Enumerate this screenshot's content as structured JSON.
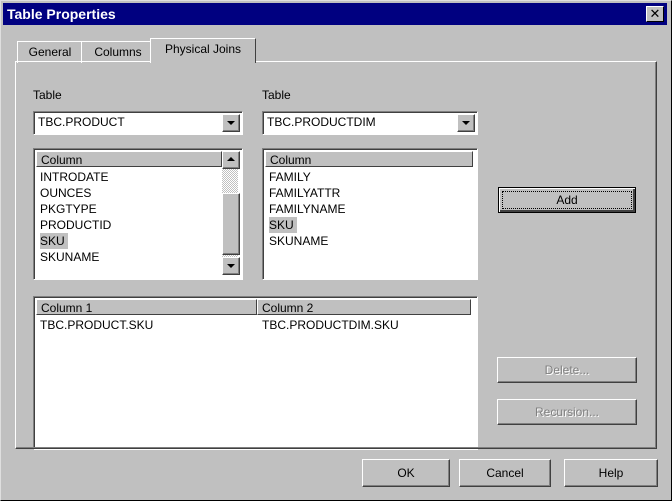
{
  "window": {
    "title": "Table Properties",
    "close_glyph": "✕"
  },
  "tabs": [
    {
      "label": "General"
    },
    {
      "label": "Columns"
    },
    {
      "label": "Physical Joins"
    }
  ],
  "left": {
    "label": "Table",
    "combo_value": "TBC.PRODUCT",
    "column_header": "Column",
    "columns": [
      "INTRODATE",
      "OUNCES",
      "PKGTYPE",
      "PRODUCTID",
      "SKU",
      "SKUNAME"
    ],
    "selected": "SKU"
  },
  "right": {
    "label": "Table",
    "combo_value": "TBC.PRODUCTDIM",
    "column_header": "Column",
    "columns": [
      "FAMILY",
      "FAMILYATTR",
      "FAMILYNAME",
      "SKU",
      "SKUNAME"
    ],
    "selected": "SKU"
  },
  "joins": {
    "headers": [
      "Column 1",
      "Column 2"
    ],
    "rows": [
      [
        "TBC.PRODUCT.SKU",
        "TBC.PRODUCTDIM.SKU"
      ]
    ]
  },
  "buttons": {
    "add": "Add",
    "delete": "Delete...",
    "recursion": "Recursion...",
    "ok": "OK",
    "cancel": "Cancel",
    "help": "Help"
  }
}
